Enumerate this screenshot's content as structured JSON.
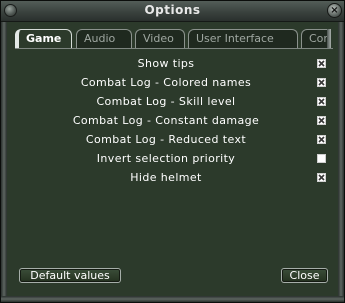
{
  "window": {
    "title": "Options",
    "close_glyph": "×"
  },
  "tabs": [
    {
      "label": "Game",
      "active": true
    },
    {
      "label": "Audio",
      "active": false
    },
    {
      "label": "Video",
      "active": false
    },
    {
      "label": "User Interface",
      "active": false
    },
    {
      "label": "Con",
      "active": false
    }
  ],
  "options": [
    {
      "label": "Show tips",
      "checked": true
    },
    {
      "label": "Combat Log - Colored names",
      "checked": true
    },
    {
      "label": "Combat Log - Skill level",
      "checked": true
    },
    {
      "label": "Combat Log - Constant damage",
      "checked": true
    },
    {
      "label": "Combat Log - Reduced text",
      "checked": true
    },
    {
      "label": "Invert selection priority",
      "checked": false
    },
    {
      "label": "Hide helmet",
      "checked": true
    }
  ],
  "buttons": {
    "default_label": "Default values",
    "close_label": "Close"
  },
  "colors": {
    "panel_bg": "#2c3a2b",
    "text": "#ffffff",
    "checkbox_fill": "#ffffff",
    "check_mark": "#3a3a3a"
  },
  "icons": {
    "check_mark": "x-mark-icon",
    "close": "close-icon"
  }
}
